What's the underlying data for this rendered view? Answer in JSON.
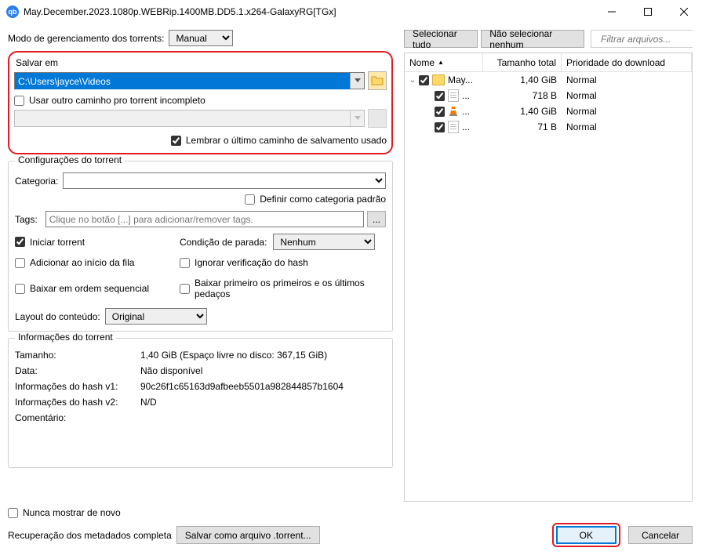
{
  "window": {
    "title": "May.December.2023.1080p.WEBRip.1400MB.DD5.1.x264-GalaxyRG[TGx]",
    "app_icon": "qb"
  },
  "mode_label": "Modo de gerenciamento dos torrents:",
  "mode_value": "Manual",
  "save_in": {
    "legend": "Salvar em",
    "path": "C:\\Users\\jayce\\Videos",
    "use_other_path_label": "Usar outro caminho pro torrent incompleto",
    "remember_label": "Lembrar o último caminho de salvamento usado"
  },
  "torrent_conf": {
    "legend": "Configurações do torrent",
    "category_label": "Categoria:",
    "default_category_label": "Definir como categoria padrão",
    "tags_label": "Tags:",
    "tags_placeholder": "Clique no botão [...] para adicionar/remover tags.",
    "start_torrent": "Iniciar torrent",
    "stop_condition_label": "Condição de parada:",
    "stop_condition_value": "Nenhum",
    "add_top_queue": "Adicionar ao início da fila",
    "skip_hash": "Ignorar verificação do hash",
    "sequential": "Baixar em ordem sequencial",
    "first_last": "Baixar primeiro os primeiros e os últimos pedaços",
    "layout_label": "Layout do conteúdo:",
    "layout_value": "Original"
  },
  "torrent_info": {
    "legend": "Informações do torrent",
    "size_label": "Tamanho:",
    "size_value": "1,40 GiB (Espaço livre no disco: 367,15 GiB)",
    "date_label": "Data:",
    "date_value": "Não disponível",
    "hash1_label": "Informações do hash v1:",
    "hash1_value": "90c26f1c65163d9afbeeb5501a982844857b1604",
    "hash2_label": "Informações do hash v2:",
    "hash2_value": "N/D",
    "comment_label": "Comentário:"
  },
  "right": {
    "select_all": "Selecionar tudo",
    "select_none": "Não selecionar nenhum",
    "filter_placeholder": "Filtrar arquivos...",
    "col_name": "Nome",
    "col_size": "Tamanho total",
    "col_prio": "Prioridade do download",
    "rows": [
      {
        "indent": 0,
        "expander": true,
        "check": true,
        "icon": "folder",
        "name": "May...",
        "size": "1,40 GiB",
        "prio": "Normal"
      },
      {
        "indent": 1,
        "expander": false,
        "check": true,
        "icon": "file",
        "name": "...",
        "size": "718 B",
        "prio": "Normal"
      },
      {
        "indent": 1,
        "expander": false,
        "check": true,
        "icon": "vlc",
        "name": "...",
        "size": "1,40 GiB",
        "prio": "Normal"
      },
      {
        "indent": 1,
        "expander": false,
        "check": true,
        "icon": "file",
        "name": "...",
        "size": "71 B",
        "prio": "Normal"
      }
    ]
  },
  "footer": {
    "never_show": "Nunca mostrar de novo",
    "metadata": "Recuperação dos metadados completa",
    "save_torrent_btn": "Salvar como arquivo .torrent...",
    "ok": "OK",
    "cancel": "Cancelar"
  }
}
